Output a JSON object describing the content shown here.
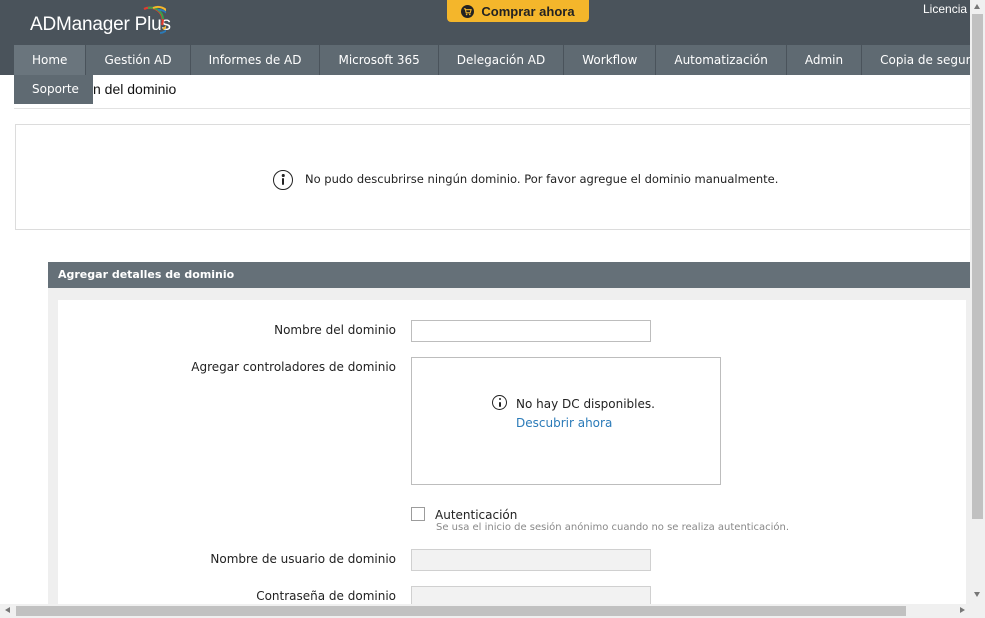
{
  "header": {
    "logo_text": "ADManager Plus",
    "buy_button": "Comprar ahora",
    "license_link": "Licencia"
  },
  "nav": {
    "items": [
      "Home",
      "Gestión AD",
      "Informes de AD",
      "Microsoft 365",
      "Delegación AD",
      "Workflow",
      "Automatización",
      "Admin",
      "Copia de seguridad"
    ],
    "dropdown_item": "Soporte"
  },
  "page": {
    "title_visible": "n del dominio"
  },
  "message": {
    "text": "No pudo descubrirse ningún dominio. Por favor agregue el dominio manualmente."
  },
  "form": {
    "section_title": "Agregar detalles de dominio",
    "domain_name_label": "Nombre del dominio",
    "domain_name_value": "",
    "dc_label": "Agregar controladores de dominio",
    "dc_empty_text": "No hay DC disponibles.",
    "dc_discover_link": "Descubrir ahora",
    "auth_label": "Autenticación",
    "auth_help": "Se usa el inicio de sesión anónimo cuando no se realiza autenticación.",
    "auth_checked": false,
    "username_label": "Nombre de usuario de dominio",
    "username_value": "",
    "password_label": "Contraseña de dominio",
    "password_value": ""
  },
  "colors": {
    "header_bg": "#4a535b",
    "nav_bg": "#5f6a72",
    "buy_button_bg": "#f4b62b",
    "section_header_bg": "#657078",
    "link": "#2a7ab8"
  },
  "icons": [
    "cart-icon",
    "info-icon",
    "logo-arc-icon"
  ]
}
